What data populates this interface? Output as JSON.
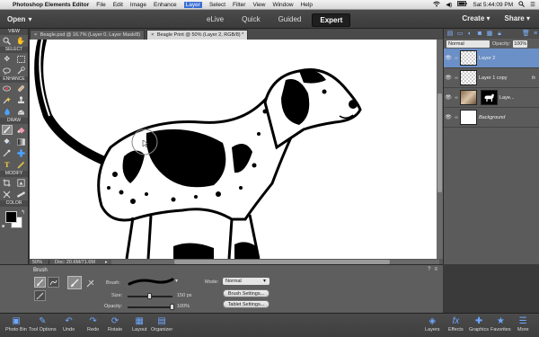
{
  "menubar": {
    "app_name": "Photoshop Elements Editor",
    "items": [
      "File",
      "Edit",
      "Image",
      "Enhance",
      "Layer",
      "Select",
      "Filter",
      "View",
      "Window",
      "Help"
    ],
    "active_item": "Layer",
    "clock": "Sat 5:44:09 PM"
  },
  "topbar": {
    "open_label": "Open",
    "modes": [
      {
        "label": "eLive",
        "active": false
      },
      {
        "label": "Quick",
        "active": false
      },
      {
        "label": "Guided",
        "active": false
      },
      {
        "label": "Expert",
        "active": true
      }
    ],
    "create_label": "Create",
    "share_label": "Share"
  },
  "toolbox": {
    "sections": {
      "view": "VIEW",
      "select": "SELECT",
      "enhance": "ENHANCE",
      "draw": "DRAW",
      "modify": "MODIFY",
      "color": "COLOR"
    },
    "text_tool": "T",
    "foreground_color": "#000000",
    "background_color": "#ffffff"
  },
  "document_tabs": [
    {
      "label": "Beagle.psd @ 16.7% (Layer 0, Layer Mask/8)",
      "active": false
    },
    {
      "label": "Beagle Print @ 50% (Layer 2, RGB/8) *",
      "active": true
    }
  ],
  "statusbar": {
    "zoom": "50%",
    "doc_size": "Doc: 20.6M/71.6M"
  },
  "layers_panel": {
    "blend_mode": "Normal",
    "opacity_label": "Opacity:",
    "opacity_value": "100%",
    "layers": [
      {
        "name": "Layer 2",
        "selected": true,
        "visible": true,
        "thumb": "checker",
        "italic": false
      },
      {
        "name": "Layer 1 copy",
        "selected": false,
        "visible": true,
        "thumb": "checker",
        "italic": false,
        "fx": "fx"
      },
      {
        "name": "Laye...",
        "selected": false,
        "visible": true,
        "thumb": "photo",
        "italic": false,
        "has_mask": true
      },
      {
        "name": "Background",
        "selected": false,
        "visible": true,
        "thumb": "white",
        "italic": true
      }
    ]
  },
  "tool_options": {
    "title": "Brush",
    "brush_label": "Brush:",
    "size_label": "Size:",
    "size_value": "150 px",
    "size_fraction": 0.5,
    "opacity_label": "Opacity:",
    "opacity_value": "100%",
    "opacity_fraction": 1.0,
    "mode_label": "Mode:",
    "mode_value": "Normal",
    "brush_settings_label": "Brush Settings...",
    "tablet_settings_label": "Tablet Settings..."
  },
  "taskbar": {
    "left": [
      {
        "label": "Photo Bin",
        "icon": "photo-bin-icon"
      },
      {
        "label": "Tool Options",
        "icon": "tool-options-icon"
      },
      {
        "label": "Undo",
        "icon": "undo-icon"
      },
      {
        "label": "Redo",
        "icon": "redo-icon"
      },
      {
        "label": "Rotate",
        "icon": "rotate-icon"
      },
      {
        "label": "Layout",
        "icon": "layout-icon"
      },
      {
        "label": "Organizer",
        "icon": "organizer-icon"
      }
    ],
    "right": [
      {
        "label": "Layers",
        "icon": "layers-icon"
      },
      {
        "label": "Effects",
        "icon": "effects-icon"
      },
      {
        "label": "Graphics",
        "icon": "graphics-icon"
      },
      {
        "label": "Favorites",
        "icon": "favorites-icon"
      },
      {
        "label": "More",
        "icon": "more-icon"
      }
    ]
  },
  "colors": {
    "accent": "#3b6fd4",
    "selected_layer": "#6b8fc7",
    "panel": "#5b5b5b"
  }
}
